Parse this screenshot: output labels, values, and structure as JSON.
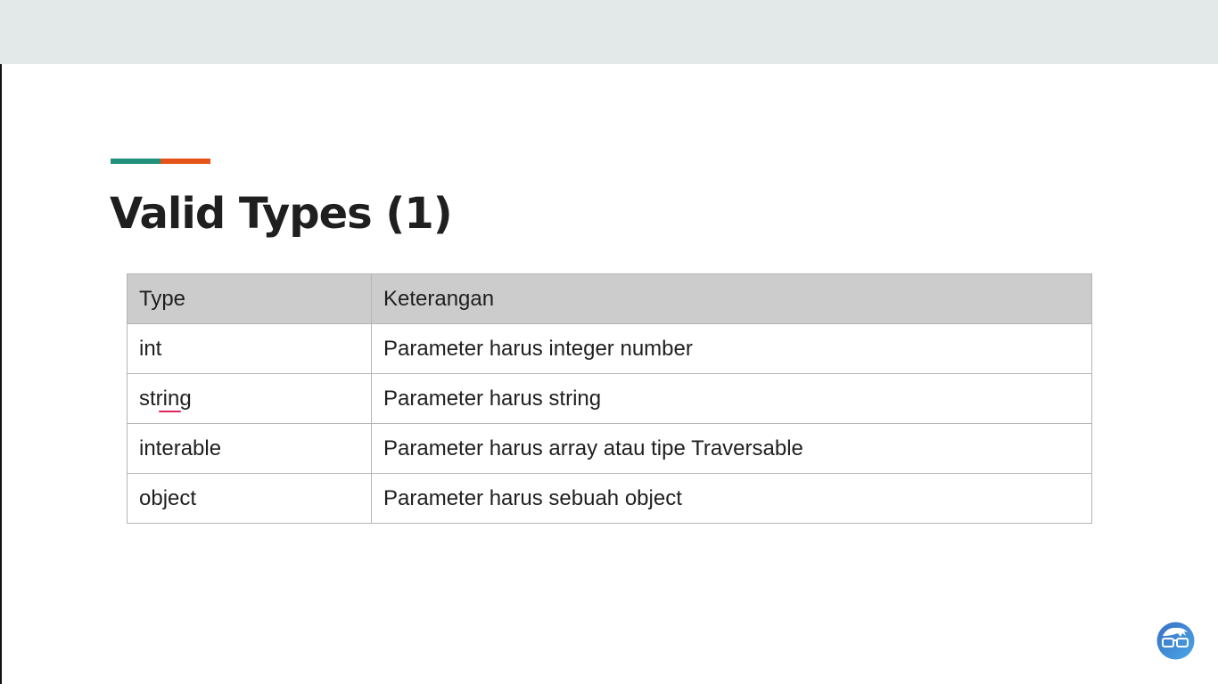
{
  "slide": {
    "title": "Valid Types (1)",
    "accent_colors": [
      "#22907c",
      "#e55318"
    ]
  },
  "table": {
    "headers": [
      "Type",
      "Keterangan"
    ],
    "rows": [
      [
        "int",
        "Parameter harus integer number"
      ],
      [
        "string",
        "Parameter harus string"
      ],
      [
        "interable",
        "Parameter harus array atau tipe Traversable"
      ],
      [
        "object",
        "Parameter harus sebuah object"
      ]
    ]
  }
}
